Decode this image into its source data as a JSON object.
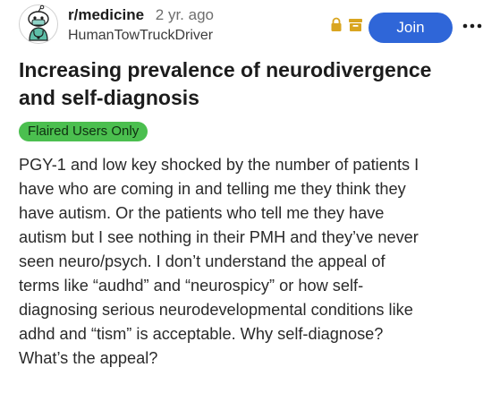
{
  "post": {
    "subreddit": "r/medicine",
    "age": "2 yr. ago",
    "author": "HumanTowTruckDriver",
    "join_label": "Join",
    "title": "Increasing prevalence of neurodivergence and self-diagnosis",
    "flair": "Flaired Users Only",
    "body_lines": [
      "PGY-1 and low key shocked by the number of patients I",
      "have who are coming in and telling me they think they",
      "have autism. Or the patients who tell me they have",
      "autism but I see nothing in their PMH and they’ve never",
      "seen neuro/psych. I don’t understand the appeal of",
      "terms like “audhd” and “neurospicy” or how self-",
      "diagnosing serious neurodevelopmental conditions like",
      "adhd and “tism” is acceptable. Why self-diagnose?",
      "What’s the appeal?"
    ]
  },
  "icons": {
    "avatar": "doctor-snoo-avatar",
    "lock": "lock-icon",
    "archive": "archive-icon",
    "more": "more-options-icon"
  },
  "colors": {
    "join_button": "#2f66d8",
    "flair_background": "#4bbf4f",
    "mod_icons": "#d9a520"
  }
}
